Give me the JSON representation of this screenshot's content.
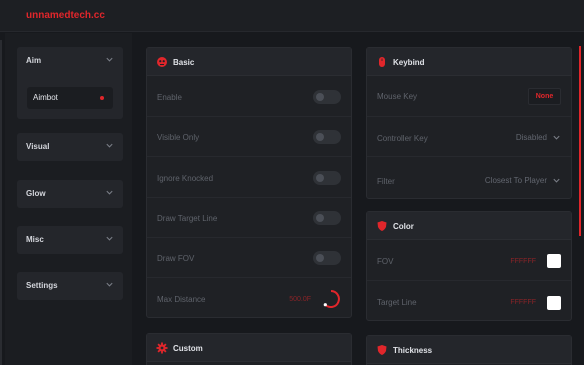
{
  "window": {
    "title": "unnamedtech.cc"
  },
  "sidebar": {
    "items": [
      {
        "label": "Aim",
        "sub": {
          "label": "Aimbot"
        }
      },
      {
        "label": "Visual"
      },
      {
        "label": "Glow"
      },
      {
        "label": "Misc"
      },
      {
        "label": "Settings"
      }
    ]
  },
  "basic": {
    "title": "Basic",
    "rows": [
      {
        "label": "Enable"
      },
      {
        "label": "Visible Only"
      },
      {
        "label": "Ignore Knocked"
      },
      {
        "label": "Draw Target Line"
      },
      {
        "label": "Draw FOV"
      },
      {
        "label": "Max Distance",
        "value": "500.0F"
      }
    ]
  },
  "keybind": {
    "title": "Keybind",
    "rows": [
      {
        "label": "Mouse Key",
        "value": "None"
      },
      {
        "label": "Controller Key",
        "value": "Disabled"
      },
      {
        "label": "Filter",
        "value": "Closest To Player"
      }
    ]
  },
  "color": {
    "title": "Color",
    "rows": [
      {
        "label": "FOV",
        "value": "FFFFFF"
      },
      {
        "label": "Target Line",
        "value": "FFFFFF"
      }
    ]
  },
  "custom": {
    "title": "Custom"
  },
  "thickness": {
    "title": "Thickness"
  },
  "colors": {
    "accent": "#e1262b",
    "swatch": "#ffffff"
  }
}
